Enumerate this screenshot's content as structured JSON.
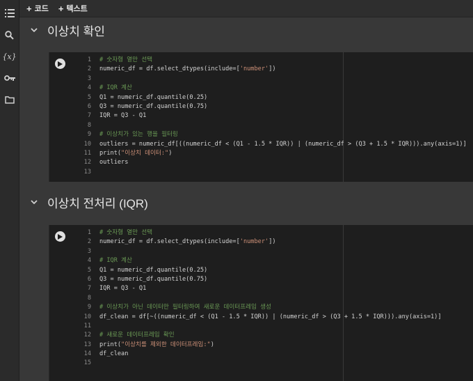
{
  "toolbar": {
    "add_code": "코드",
    "add_text": "텍스트"
  },
  "sidebar": {
    "icons": [
      "toc-icon",
      "search-icon",
      "variables-icon",
      "secrets-key-icon",
      "files-folder-icon"
    ],
    "variables_label": "{x}"
  },
  "sections": [
    {
      "title": "이상치 확인",
      "code": [
        "# 숫자형 열만 선택",
        "numeric_df = df.select_dtypes(include=['number'])",
        "",
        "# IQR 계산",
        "Q1 = numeric_df.quantile(0.25)",
        "Q3 = numeric_df.quantile(0.75)",
        "IQR = Q3 - Q1",
        "",
        "# 이상치가 있는 행을 필터링",
        "outliers = numeric_df[((numeric_df < (Q1 - 1.5 * IQR)) | (numeric_df > (Q3 + 1.5 * IQR))).any(axis=1)]",
        "print(\"이상치 데이터:\")",
        "outliers",
        ""
      ]
    },
    {
      "title": "이상치 전처리 (IQR)",
      "code": [
        "# 숫자형 열만 선택",
        "numeric_df = df.select_dtypes(include=['number'])",
        "",
        "# IQR 계산",
        "Q1 = numeric_df.quantile(0.25)",
        "Q3 = numeric_df.quantile(0.75)",
        "IQR = Q3 - Q1",
        "",
        "# 이상치가 아닌 데이터만 필터링하여 새로운 데이터프레임 생성",
        "df_clean = df[~((numeric_df < (Q1 - 1.5 * IQR)) | (numeric_df > (Q3 + 1.5 * IQR))).any(axis=1)]",
        "",
        "# 새로운 데이터프레임 확인",
        "print(\"이상치를 제외한 데이터프레임:\")",
        "df_clean",
        ""
      ]
    }
  ],
  "colors": {
    "comment": "#6a9955",
    "string": "#ce9178",
    "function": "#dcdcaa",
    "text": "#d4d4d4"
  }
}
